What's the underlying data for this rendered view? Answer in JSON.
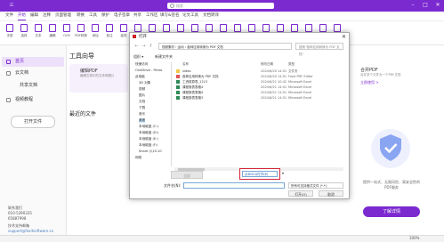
{
  "app": {
    "menu_label": "三",
    "search_placeholder": "搜索"
  },
  "menubar": {
    "items": [
      "文件",
      "开始",
      "编辑",
      "注释",
      "页面管理",
      "转换",
      "工具",
      "保护",
      "电子签章",
      "共享",
      "工作区",
      "填写&签名",
      "论文工具",
      "文档转译"
    ]
  },
  "toolbar": {
    "tools": [
      "手型",
      "选择",
      "文本",
      "编辑",
      "OCR",
      "PDF转换",
      "添加",
      "批注",
      "高亮",
      "删除线",
      "下划线",
      "图像",
      "链接",
      "附件",
      "表单",
      "签名",
      "对比",
      "字数",
      "搜索",
      "加密",
      "保护",
      "全屏",
      "翻译",
      "设置"
    ]
  },
  "sidebar": {
    "items": [
      "首页",
      "云文档",
      "共享文档",
      "视频教程"
    ],
    "open_file": "打开文件",
    "contact": [
      "联系我们",
      "010-5390335",
      "65887998",
      "技术支持邮箱",
      "support@foxitsoftware.cn"
    ]
  },
  "main": {
    "tools_title": "工具向导",
    "card1": {
      "title": "编辑PDF",
      "desc": "编辑文档中的文本和图片"
    },
    "recent_title": "最近的文件",
    "card2": {
      "title": "合并PDF",
      "desc": "合并多个文件为一个PDF文档",
      "link": "立即使用 >"
    },
    "promo": "提供一站式、无限风险、高安全性的PDF服务",
    "upgrade": "了解详情"
  },
  "status": {
    "zoom": "100%"
  },
  "dialog": {
    "title": "打开",
    "close": "✕",
    "breadcrumb": "视频素材 › 运动 › 各种应用转换为 PDF 文档",
    "search_placeholder": "搜索\"各种应用转换为 PDF 文档\"",
    "cmd_organize": "组织 ▾",
    "cmd_new_folder": "新建文件夹",
    "nav_items": [
      "快速访问",
      "OneDrive - Perso",
      "此电脑",
      "3D 对象",
      "视频",
      "图片",
      "文档",
      "下载",
      "音乐",
      "桌面",
      "本地磁盘 (C:)",
      "本地磁盘 (D:)",
      "本地磁盘 (E:)",
      "本地磁盘 (F:)",
      "Share (\\\\10.10",
      "网络"
    ],
    "columns": [
      "名称",
      "修改日期",
      "类型"
    ],
    "files": [
      {
        "name": "video",
        "date": "2024/6/20 14:51",
        "type": "文件夹"
      },
      {
        "name": "各种应用转换为 PDF 文档",
        "date": "2024/6/20 14:51",
        "type": "Foxit PDF Editor"
      },
      {
        "name": "工资核算表_1213",
        "date": "2024/6/21 10:42",
        "type": "Microsoft Excel"
      },
      {
        "name": "课程报表表格4",
        "date": "2024/6/21 14:51",
        "type": "Microsoft Excel"
      },
      {
        "name": "课程报表表格4",
        "date": "2024/6/21 14:51",
        "type": "Microsoft Excel"
      },
      {
        "name": "课程报表表格3",
        "date": "2024/6/21 14:51",
        "type": "Microsoft Excel"
      }
    ],
    "disabled_btn": "全部",
    "encoding": "从DOCX打开(E)",
    "filename_label": "文件名(N):",
    "filetype": "所有可支持格式文件 (*.*)",
    "open": "打开(O)",
    "cancel": "取消"
  },
  "colors": {
    "brand": "#7b2ad0",
    "highlight": "#d6263a"
  }
}
